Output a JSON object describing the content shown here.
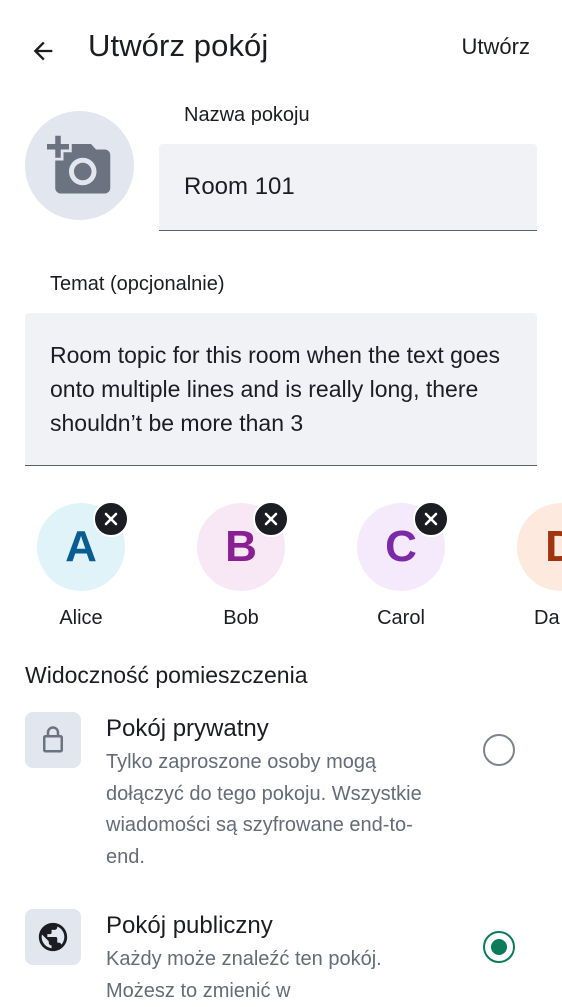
{
  "header": {
    "title": "Utwórz pokój",
    "create_label": "Utwórz"
  },
  "room_name": {
    "label": "Nazwa pokoju",
    "value": "Room 101"
  },
  "topic": {
    "label": "Temat (opcjonalnie)",
    "value": "Room topic for this room when the text goes onto multiple lines and is really long, there shouldn’t be more than 3"
  },
  "members": [
    {
      "initial": "A",
      "name": "Alice",
      "bg": "#dff3f8",
      "fg": "#0a5d91"
    },
    {
      "initial": "B",
      "name": "Bob",
      "bg": "#f8e8f6",
      "fg": "#8a1f93"
    },
    {
      "initial": "C",
      "name": "Carol",
      "bg": "#f4eafb",
      "fg": "#7a2aa8"
    },
    {
      "initial": "D",
      "name": "Da",
      "bg": "#fde9dd",
      "fg": "#a2330f"
    }
  ],
  "visibility": {
    "title": "Widoczność pomieszczenia",
    "private": {
      "title": "Pokój prywatny",
      "description": "Tylko zaproszone osoby mogą dołączyć do tego pokoju. Wszystkie wiadomości są szyfrowane end-to-end.",
      "selected": false,
      "icon": "lock-icon"
    },
    "public": {
      "title": "Pokój publiczny",
      "description": "Każdy może znaleźć ten pokój. Możesz to zmienić w",
      "selected": true,
      "icon": "globe-icon"
    }
  },
  "colors": {
    "accent": "#0b7b5a",
    "surface": "#f0f2f6"
  }
}
